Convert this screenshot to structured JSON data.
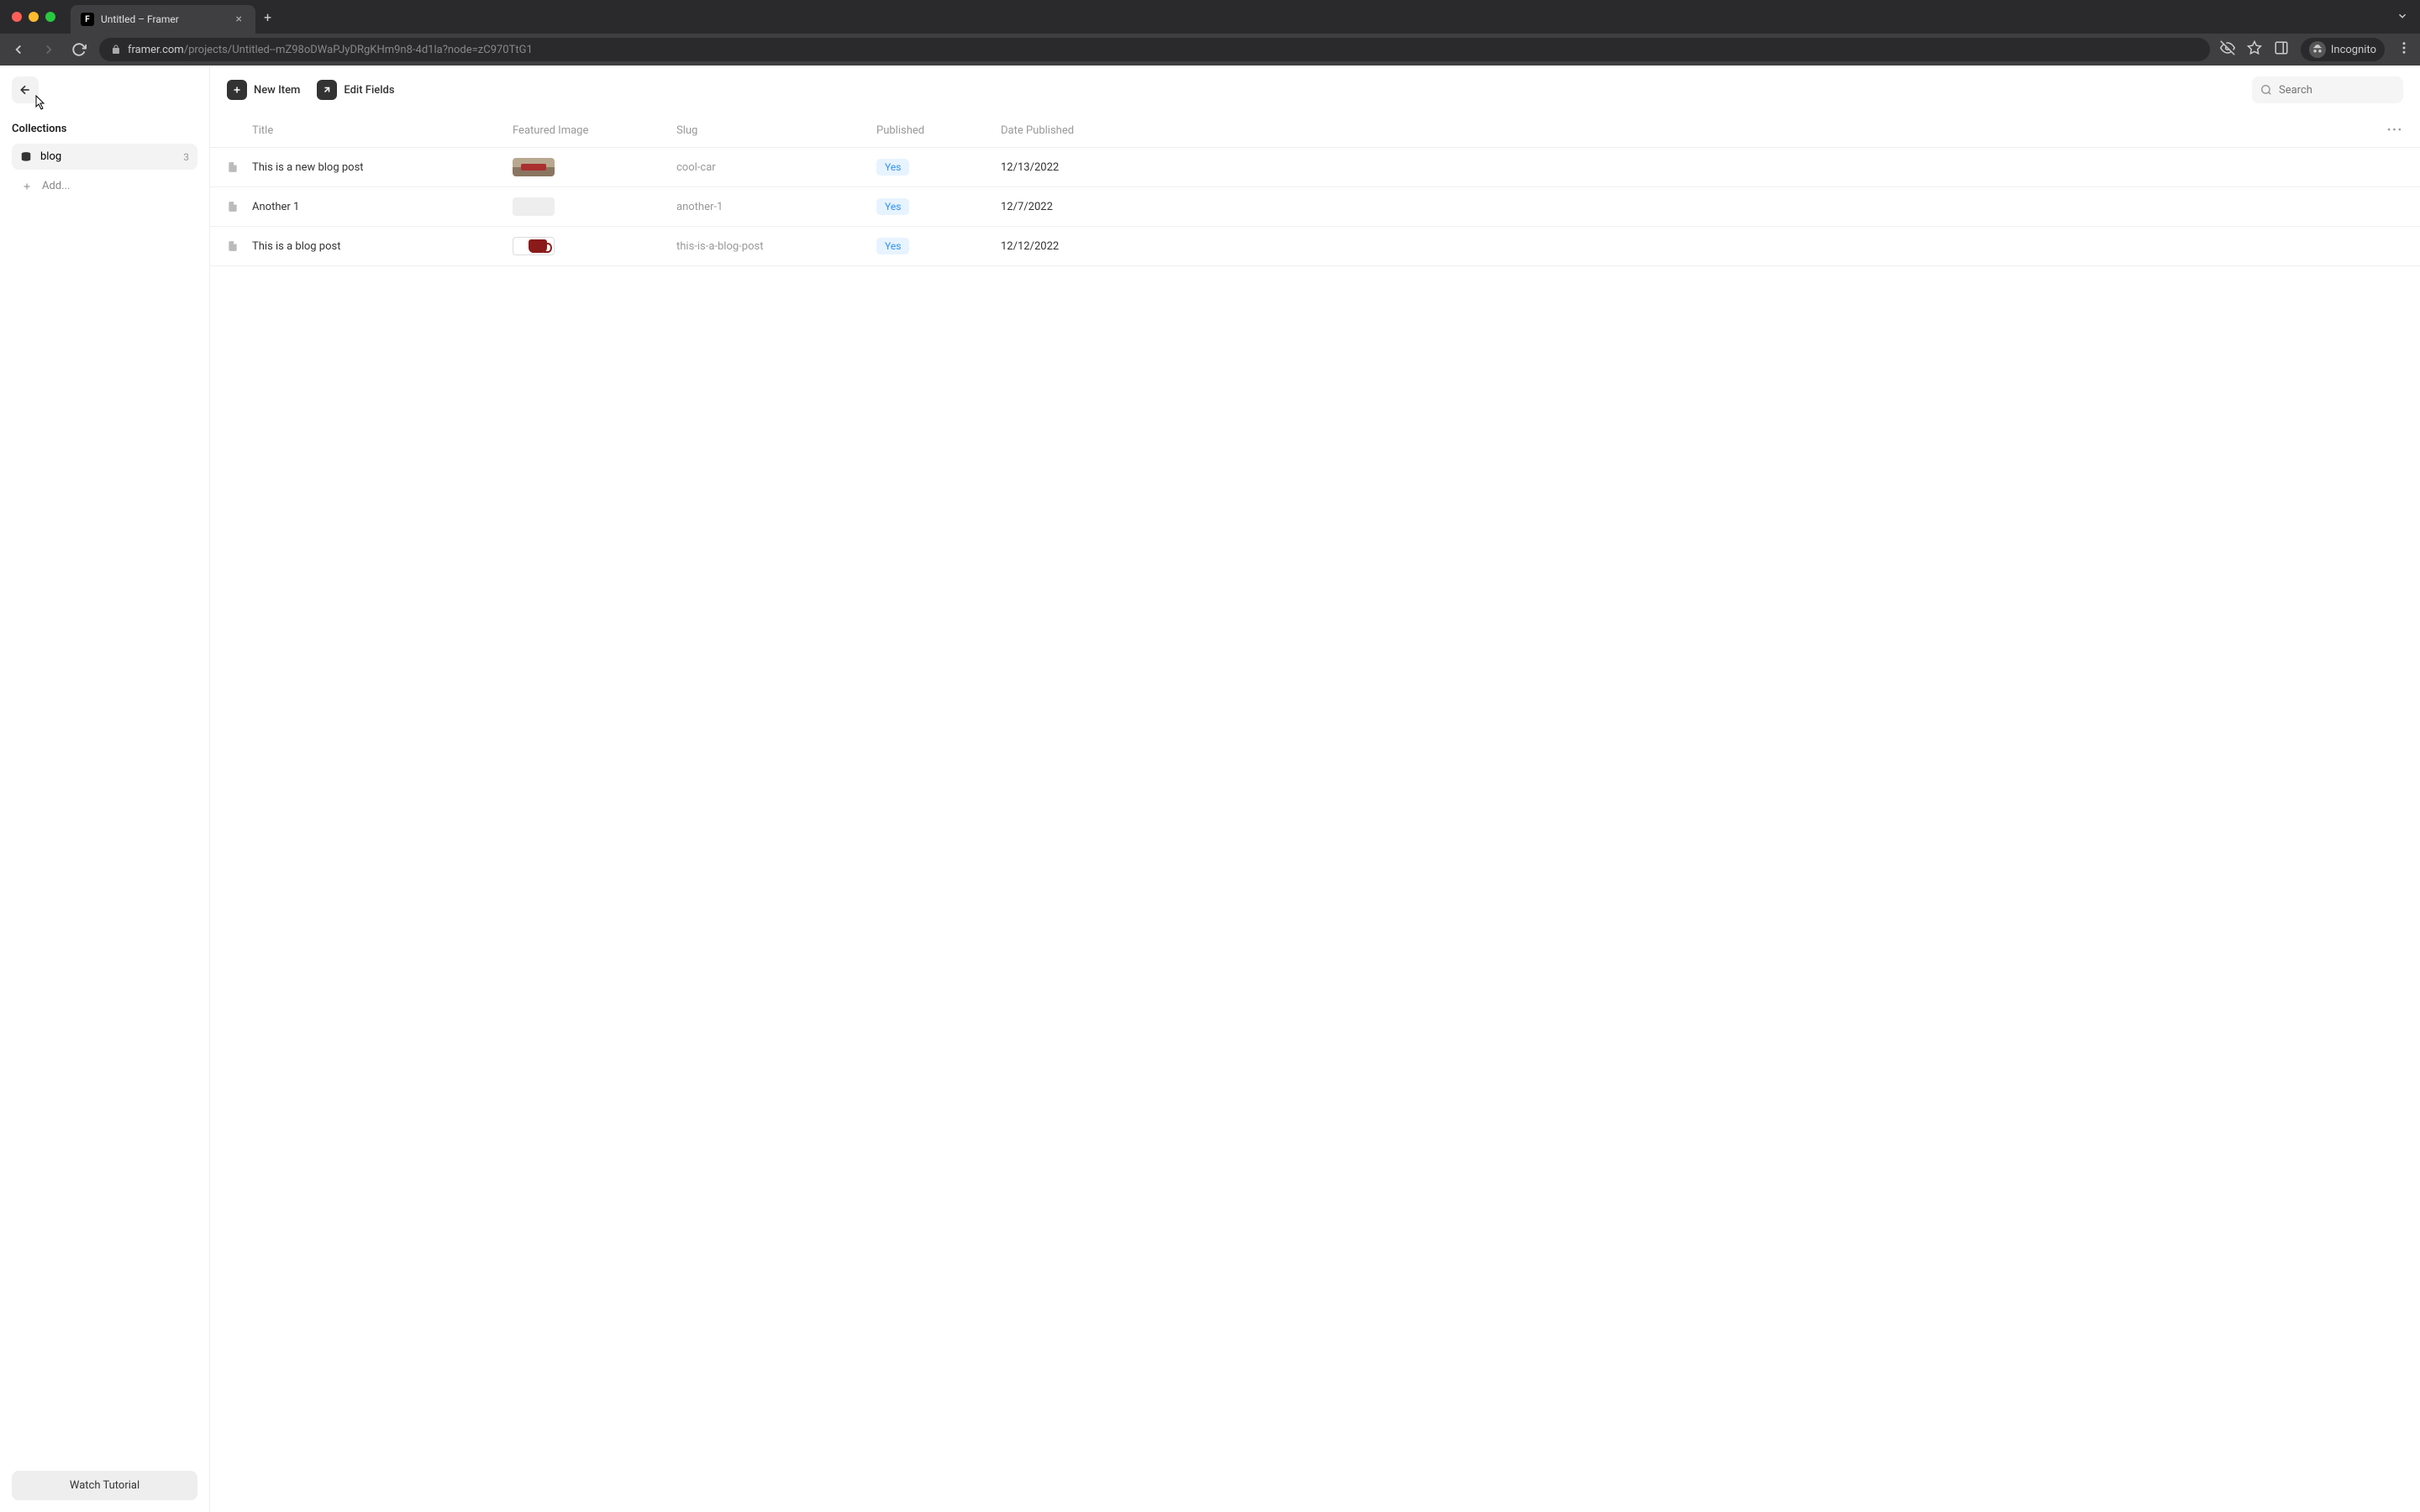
{
  "browser": {
    "tab_title": "Untitled – Framer",
    "url_host": "framer.com",
    "url_path": "/projects/Untitled--mZ98oDWaPJyDRgKHm9n8-4d1la?node=zC970TtG1",
    "incognito_label": "Incognito"
  },
  "toolbar": {
    "new_item_label": "New Item",
    "edit_fields_label": "Edit Fields",
    "search_placeholder": "Search"
  },
  "sidebar": {
    "section_title": "Collections",
    "items": [
      {
        "label": "blog",
        "count": "3"
      }
    ],
    "add_label": "Add...",
    "tutorial_label": "Watch Tutorial"
  },
  "table": {
    "headers": {
      "title": "Title",
      "featured_image": "Featured Image",
      "slug": "Slug",
      "published": "Published",
      "date_published": "Date Published"
    },
    "rows": [
      {
        "title": "This is a new blog post",
        "slug": "cool-car",
        "published": "Yes",
        "date": "12/13/2022",
        "thumb": "car"
      },
      {
        "title": "Another 1",
        "slug": "another-1",
        "published": "Yes",
        "date": "12/7/2022",
        "thumb": "empty"
      },
      {
        "title": "This is a blog post",
        "slug": "this-is-a-blog-post",
        "published": "Yes",
        "date": "12/12/2022",
        "thumb": "mug"
      }
    ]
  }
}
